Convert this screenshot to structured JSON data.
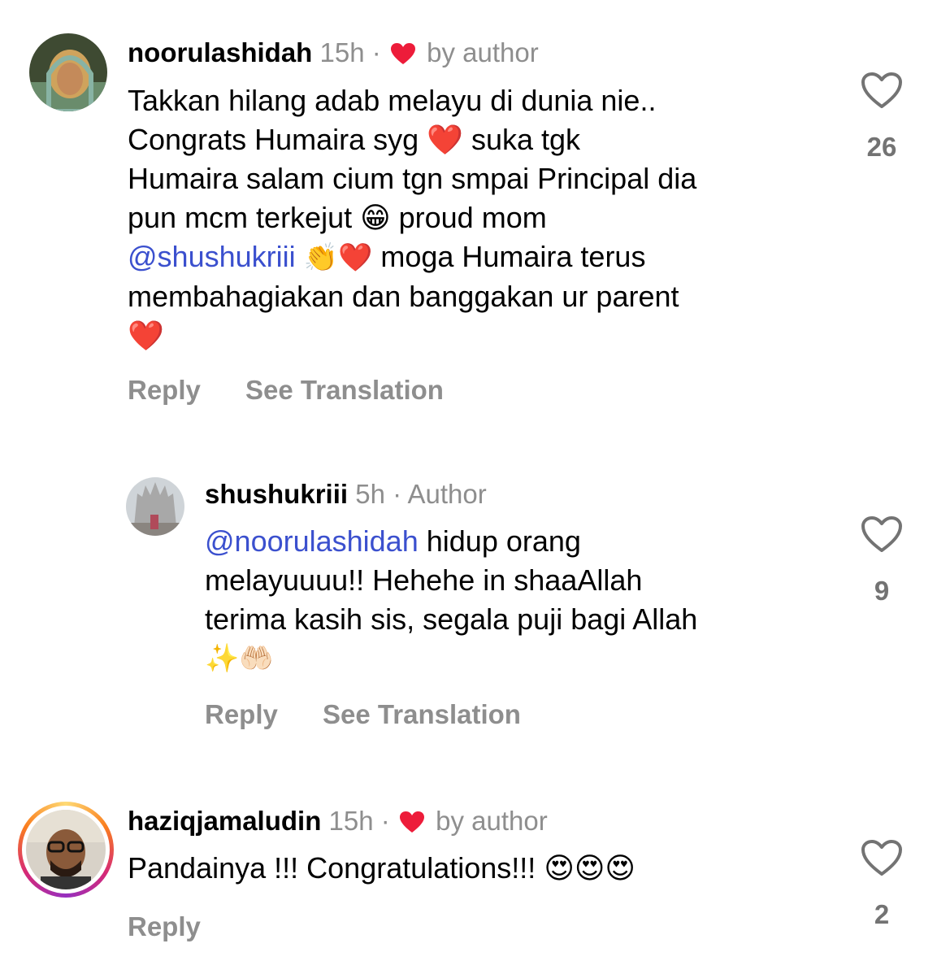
{
  "comments": [
    {
      "username": "noorulashidah",
      "time": "15h",
      "badge": "by author",
      "text_lines": [
        "Takkan hilang adab melayu di dunia nie..",
        "Congrats Humaira syg ❤️ suka tgk",
        "Humaira salam cium tgn smpai Principal dia",
        "pun mcm terkejut 😁 proud mom",
        "moga Humaira terus",
        "membahagiakan dan banggakan ur parent",
        "❤️"
      ],
      "mention": "@shushukriii",
      "mention_emoji": "👏❤️",
      "reply_label": "Reply",
      "translate_label": "See Translation",
      "likes": "26"
    },
    {
      "username": "shushukriii",
      "time": "5h",
      "badge": "Author",
      "mention": "@noorulashidah",
      "text_lines": [
        "hidup orang",
        "melayuuuu!! Hehehe in shaaAllah",
        "terima kasih sis, segala puji bagi Allah",
        "✨🤲🏻"
      ],
      "reply_label": "Reply",
      "translate_label": "See Translation",
      "likes": "9"
    },
    {
      "username": "haziqjamaludin",
      "time": "15h",
      "badge": "by author",
      "text": "Pandainya !!! Congratulations!!! 😍😍😍",
      "reply_label": "Reply",
      "likes": "2"
    }
  ],
  "colors": {
    "mention": "#3b50ce",
    "secondary_text": "#8e8e8e",
    "heart_red": "#ed1c3a",
    "story_ring": "#d62976"
  },
  "icons": {
    "like": "heart-outline-icon",
    "author_like": "heart-filled-icon"
  }
}
